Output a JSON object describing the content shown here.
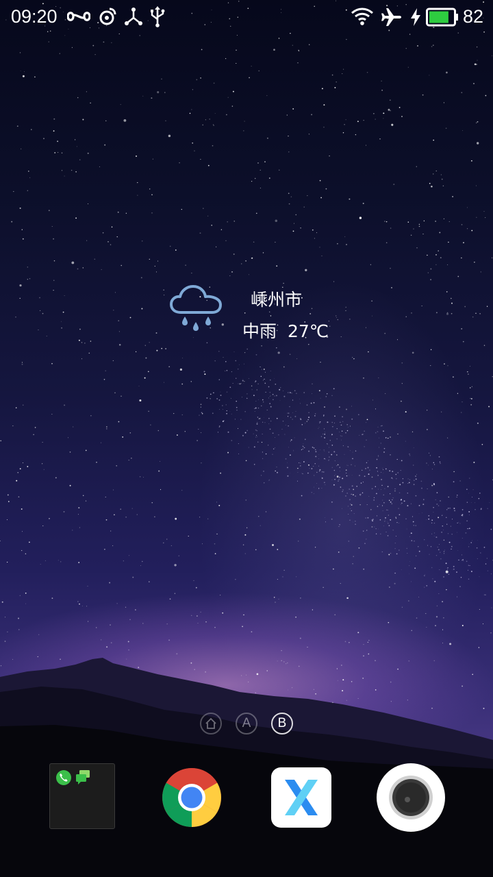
{
  "status_bar": {
    "time": "09:20",
    "battery_level": "82",
    "left_icons": [
      "infinity-icon",
      "weibo-icon",
      "share-nodes-icon",
      "usb-icon"
    ],
    "right_icons": [
      "wifi-icon",
      "airplane-icon",
      "charging-bolt-icon",
      "battery-icon"
    ]
  },
  "weather": {
    "city": "嵊州市",
    "condition": "中雨",
    "temperature": "27℃",
    "icon": "rain-cloud-icon"
  },
  "page_indicators": [
    {
      "label": "home-icon",
      "active": false
    },
    {
      "label": "A",
      "active": false
    },
    {
      "label": "B",
      "active": true
    }
  ],
  "dock": {
    "apps": [
      {
        "name": "phone-messages-folder"
      },
      {
        "name": "chrome-icon"
      },
      {
        "name": "x-browser-icon"
      },
      {
        "name": "camera-icon"
      }
    ]
  },
  "colors": {
    "battery_fill": "#2ecc40",
    "weather_icon": "#7fa9d6",
    "x_blue": "#2b8cf0",
    "x_light_blue": "#5fd0f5"
  }
}
